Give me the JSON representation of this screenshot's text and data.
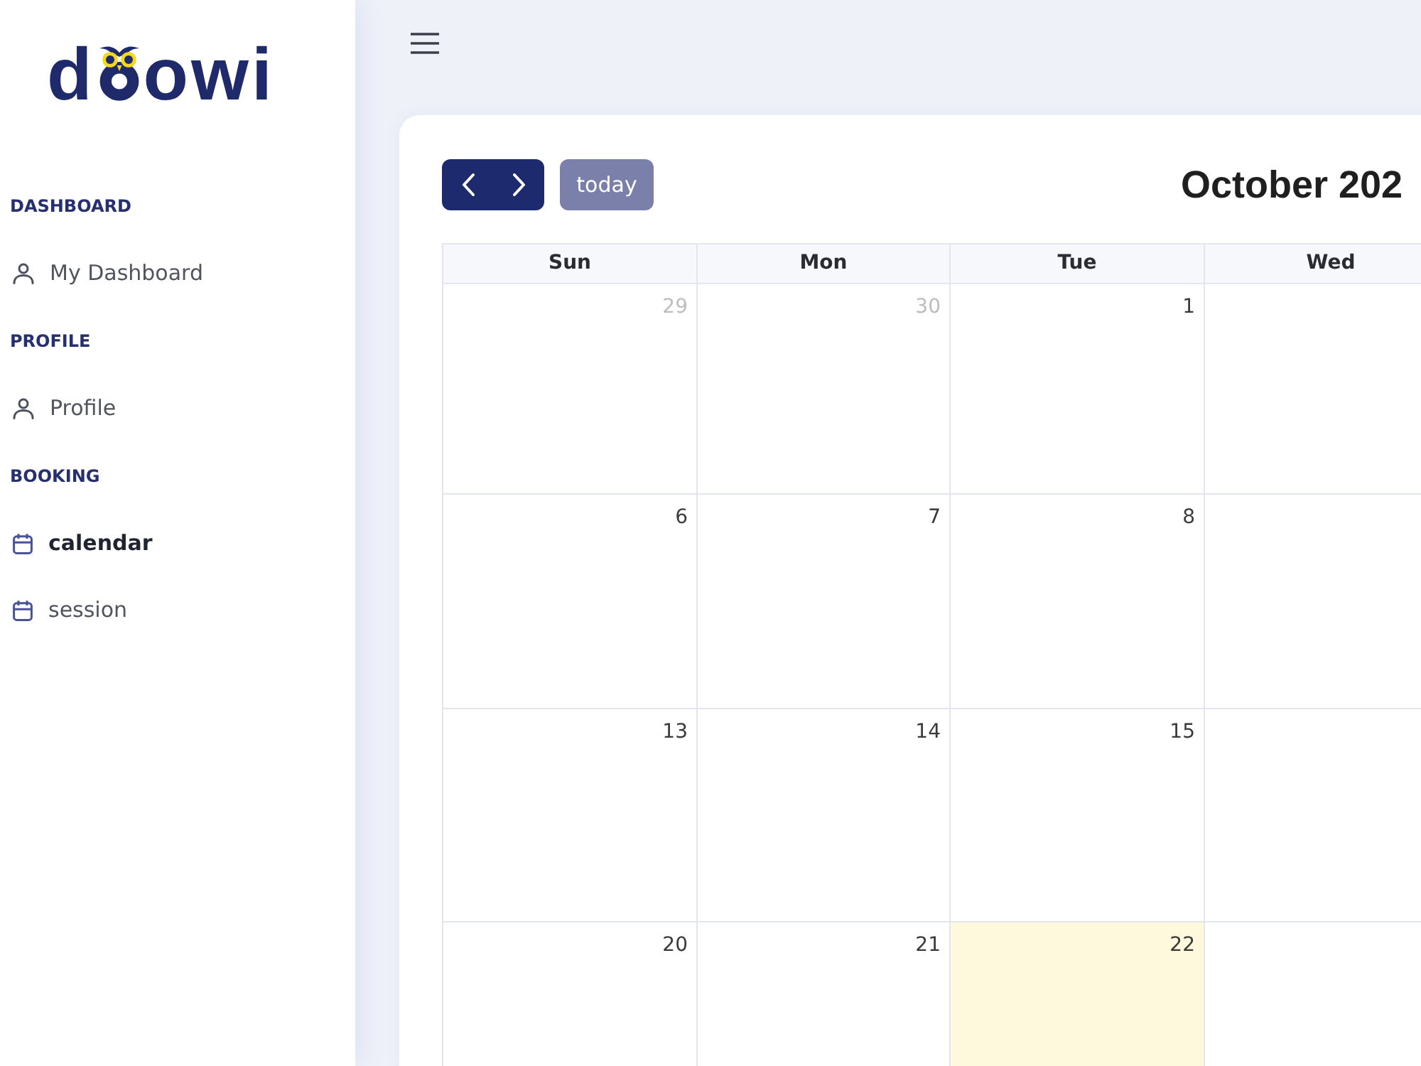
{
  "sidebar": {
    "logo": [
      "d",
      "owi"
    ],
    "sections": [
      {
        "title": "DASHBOARD",
        "items": [
          {
            "label": "My Dashboard",
            "kind": "person",
            "selected": false
          }
        ]
      },
      {
        "title": "PROFILE",
        "items": [
          {
            "label": "Profile",
            "kind": "person",
            "selected": false
          }
        ]
      },
      {
        "title": "BOOKING",
        "items": [
          {
            "label": "calendar",
            "kind": "calendar",
            "selected": true
          },
          {
            "label": "session",
            "kind": "calendar",
            "selected": false
          }
        ]
      }
    ]
  },
  "calendar": {
    "today_button": {
      "label": "today",
      "disabled": true
    },
    "title": "October 202",
    "weekdays": [
      "Sun",
      "Mon",
      "Tue",
      "Wed"
    ],
    "weeks": [
      [
        {
          "day": "29",
          "other_month": true,
          "today": false
        },
        {
          "day": "30",
          "other_month": true,
          "today": false
        },
        {
          "day": "1",
          "other_month": false,
          "today": false
        }
      ],
      [
        {
          "day": "6",
          "other_month": false,
          "today": false
        },
        {
          "day": "7",
          "other_month": false,
          "today": false
        },
        {
          "day": "8",
          "other_month": false,
          "today": false
        }
      ],
      [
        {
          "day": "13",
          "other_month": false,
          "today": false
        },
        {
          "day": "14",
          "other_month": false,
          "today": false
        },
        {
          "day": "15",
          "other_month": false,
          "today": false
        }
      ],
      [
        {
          "day": "20",
          "other_month": false,
          "today": false
        },
        {
          "day": "21",
          "other_month": false,
          "today": false
        },
        {
          "day": "22",
          "other_month": false,
          "today": true
        }
      ]
    ]
  }
}
